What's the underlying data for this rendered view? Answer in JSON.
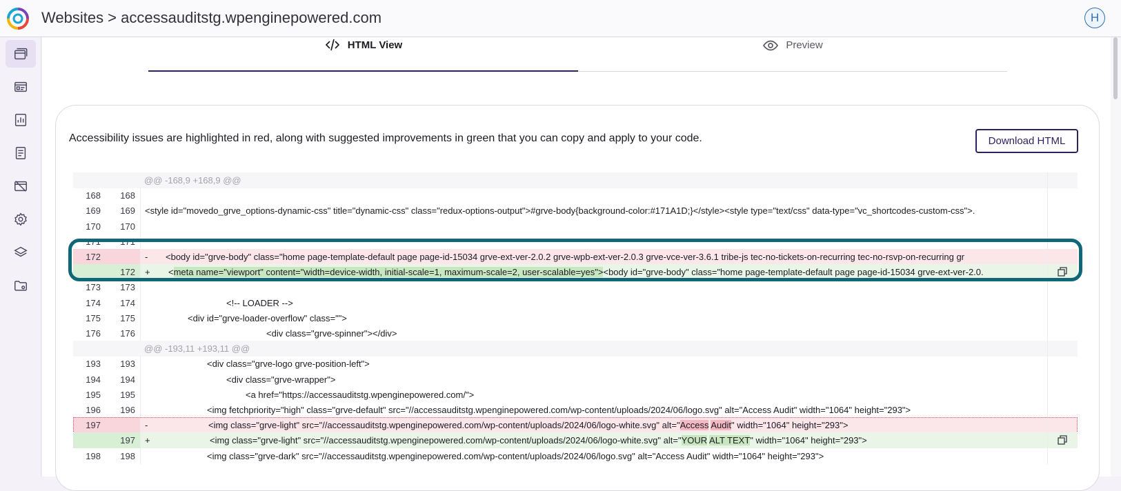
{
  "header": {
    "title": "Websites > accessauditstg.wpenginepowered.com",
    "avatar_initial": "H"
  },
  "sidebar": {
    "items": [
      {
        "name": "websites",
        "icon": "browser-windows-icon",
        "active": true
      },
      {
        "name": "dashboard",
        "icon": "id-card-icon",
        "active": false
      },
      {
        "name": "reports",
        "icon": "chart-report-icon",
        "active": false
      },
      {
        "name": "documents",
        "icon": "document-icon",
        "active": false
      },
      {
        "name": "monitoring",
        "icon": "broken-browser-icon",
        "active": false
      },
      {
        "name": "settings",
        "icon": "gear-icon",
        "active": false
      },
      {
        "name": "layers",
        "icon": "layers-icon",
        "active": false
      },
      {
        "name": "folders",
        "icon": "folder-settings-icon",
        "active": false
      }
    ]
  },
  "tabs": {
    "html_view": "HTML View",
    "preview": "Preview"
  },
  "notice": "Accessibility issues are highlighted in red, along with suggested improvements in green that you can copy and apply to your code.",
  "download_label": "Download HTML",
  "diff": {
    "rows": [
      {
        "type": "hunk",
        "text": "@@ -168,9 +168,9 @@"
      },
      {
        "type": "ctx",
        "l": "168",
        "r": "168",
        "text": ""
      },
      {
        "type": "ctx",
        "l": "169",
        "r": "169",
        "text": "<style id=\"movedo_grve_options-dynamic-css\" title=\"dynamic-css\" class=\"redux-options-output\">#grve-body{background-color:#171A1D;}</style><style type=\"text/css\" data-type=\"vc_shortcodes-custom-css\">."
      },
      {
        "type": "ctx",
        "l": "170",
        "r": "170",
        "text": ""
      },
      {
        "type": "ctx",
        "l": "171",
        "r": "171",
        "text": ""
      },
      {
        "type": "del",
        "l": "172",
        "r": "",
        "sign": "-",
        "text": "<body id=\"grve-body\" class=\"home page-template-default page page-id-15034 grve-ext-ver-2.0.2 grve-wpb-ext-ver-2.0.3 grve-vce-ver-3.6.1 tribe-js tec-no-tickets-on-recurring tec-no-rsvp-on-recurring gr"
      },
      {
        "type": "add",
        "l": "",
        "r": "172",
        "sign": "+",
        "hl": "meta name=\"viewport\" content=\"width=device-width, initial-scale=1, maximum-scale=2, user-scalable=yes\">",
        "pre": "<",
        "text": "<body id=\"grve-body\" class=\"home page-template-default page page-id-15034 grve-ext-ver-2.0."
      },
      {
        "type": "ctx",
        "l": "173",
        "r": "173",
        "text": ""
      },
      {
        "type": "ctx",
        "l": "174",
        "r": "174",
        "text": "<!-- LOADER -->"
      },
      {
        "type": "ctx",
        "l": "175",
        "r": "175",
        "text": "<div id=\"grve-loader-overflow\" class=\"\">"
      },
      {
        "type": "ctx",
        "l": "176",
        "r": "176",
        "text": "<div class=\"grve-spinner\"></div>"
      },
      {
        "type": "hunk",
        "text": "@@ -193,11 +193,11 @@"
      },
      {
        "type": "ctx",
        "l": "193",
        "r": "193",
        "text": "<div class=\"grve-logo grve-position-left\">"
      },
      {
        "type": "ctx",
        "l": "194",
        "r": "194",
        "text": "<div class=\"grve-wrapper\">"
      },
      {
        "type": "ctx",
        "l": "195",
        "r": "195",
        "text": "<a href=\"https://accessauditstg.wpenginepowered.com/\">"
      },
      {
        "type": "ctx",
        "l": "196",
        "r": "196",
        "text": "<img fetchpriority=\"high\" class=\"grve-default\" src=\"//accessauditstg.wpenginepowered.com/wp-content/uploads/2024/06/logo.svg\" alt=\"Access Audit\" width=\"1064\" height=\"293\">"
      },
      {
        "type": "del",
        "l": "197",
        "r": "",
        "sign": "-",
        "pre": "<img class=\"grve-light\" src=\"//accessauditstg.wpenginepowered.com/wp-content/uploads/2024/06/logo-white.svg\" alt=\"",
        "hl1": "Access",
        "mid": " ",
        "hl2": "Audit",
        "text": "\" width=\"1064\" height=\"293\">"
      },
      {
        "type": "add",
        "l": "",
        "r": "197",
        "sign": "+",
        "pre": "<img class=\"grve-light\" src=\"//accessauditstg.wpenginepowered.com/wp-content/uploads/2024/06/logo-white.svg\" alt=\"",
        "hl1": "YOUR",
        "mid": " ",
        "hl2": "ALT TEXT",
        "text": "\" width=\"1064\" height=\"293\">"
      },
      {
        "type": "ctx",
        "l": "198",
        "r": "198",
        "text": "<img class=\"grve-dark\" src=\"//accessauditstg.wpenginepowered.com/wp-content/uploads/2024/06/logo.svg\" alt=\"Access Audit\" width=\"1064\" height=\"293\">"
      }
    ]
  }
}
